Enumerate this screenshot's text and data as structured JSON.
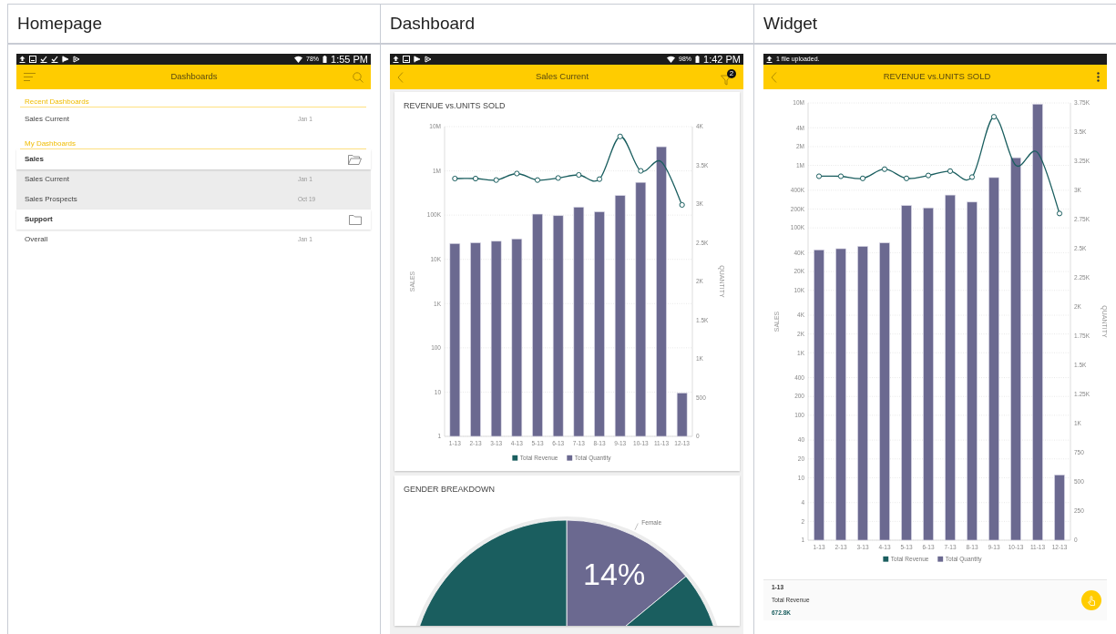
{
  "headings": [
    "Homepage",
    "Dashboard",
    "Widget"
  ],
  "homepage": {
    "status_bar": {
      "battery": "78%",
      "time": "1:55 PM"
    },
    "app_bar": {
      "title": "Dashboards"
    },
    "sections": [
      {
        "title": "Recent Dashboards",
        "items": [
          {
            "kind": "item",
            "label": "Sales Current",
            "date": "Jan 1"
          }
        ]
      },
      {
        "title": "My Dashboards",
        "items": [
          {
            "kind": "folder",
            "label": "Sales",
            "expanded": true,
            "children": [
              {
                "label": "Sales Current",
                "date": "Jan 1"
              },
              {
                "label": "Sales Prospects",
                "date": "Oct 19"
              }
            ]
          },
          {
            "kind": "folder",
            "label": "Support",
            "expanded": false
          },
          {
            "kind": "item",
            "label": "Overall",
            "date": "Jan 1"
          }
        ]
      }
    ]
  },
  "dashboard": {
    "status_bar": {
      "battery": "98%",
      "time": "1:42 PM"
    },
    "app_bar": {
      "title": "Sales Current",
      "filter_count": "2"
    },
    "widgets": [
      {
        "kind": "combo",
        "chart_data": {
          "type": "bar",
          "title": "REVENUE vs.UNITS SOLD",
          "ylabel": "SALES",
          "y2label": "QUANTITY",
          "log": true,
          "grid": true,
          "legend": "bottom",
          "ylim": [
            1,
            10000000
          ],
          "y2lim": [
            0,
            4000
          ],
          "categories": [
            "1-13",
            "2-13",
            "3-13",
            "4-13",
            "5-13",
            "6-13",
            "7-13",
            "8-13",
            "9-13",
            "10-13",
            "11-13",
            "12-13"
          ],
          "yticks": [
            {
              "value": 1,
              "label": "1"
            },
            {
              "value": 10,
              "label": "10"
            },
            {
              "value": 100,
              "label": "100"
            },
            {
              "value": 1000,
              "label": "1K"
            },
            {
              "value": 10000,
              "label": "10K"
            },
            {
              "value": 100000,
              "label": "100K"
            },
            {
              "value": 1000000,
              "label": "1M"
            },
            {
              "value": 10000000,
              "label": "10M"
            }
          ],
          "y2ticks": [
            {
              "value": 0,
              "label": "0"
            },
            {
              "value": 500,
              "label": "500"
            },
            {
              "value": 1000,
              "label": "1K"
            },
            {
              "value": 1500,
              "label": "1.5K"
            },
            {
              "value": 2000,
              "label": "2K"
            },
            {
              "value": 2500,
              "label": "2.5K"
            },
            {
              "value": 3000,
              "label": "3K"
            },
            {
              "value": 3500,
              "label": "3.5K"
            },
            {
              "value": 4000,
              "label": "4K"
            }
          ],
          "series": [
            {
              "name": "Total Revenue",
              "color": "#1a5e5f",
              "type": "line",
              "marker": true,
              "values": [
                670000,
                670000,
                620000,
                870000,
                620000,
                690000,
                810000,
                650000,
                6000000,
                1000000,
                1600000,
                170000
              ]
            },
            {
              "name": "Total Quantity",
              "color": "#6b6990",
              "axis": "y2",
              "values": [
                2490,
                2500,
                2520,
                2550,
                2870,
                2850,
                2960,
                2900,
                3110,
                3280,
                3740,
                560
              ]
            }
          ]
        }
      },
      {
        "kind": "pie",
        "chart_data": {
          "type": "pie",
          "title": "GENDER BREAKDOWN",
          "categories": [
            "Female",
            null
          ],
          "values": [
            14,
            86
          ],
          "value_labels": [
            "14%",
            null
          ]
        }
      }
    ]
  },
  "widget": {
    "notification": "1 file uploaded.",
    "app_bar": {
      "title": "REVENUE vs.UNITS SOLD"
    },
    "chart_data": {
      "type": "bar",
      "ylabel": "SALES",
      "y2label": "QUANTITY",
      "log": true,
      "grid": true,
      "legend": "bottom",
      "ylim": [
        1,
        10000000
      ],
      "y2lim": [
        0,
        3750
      ],
      "categories": [
        "1-13",
        "2-13",
        "3-13",
        "4-13",
        "5-13",
        "6-13",
        "7-13",
        "8-13",
        "9-13",
        "10-13",
        "11-13",
        "12-13"
      ],
      "yticks": [
        {
          "value": 1,
          "label": "1"
        },
        {
          "value": 2,
          "label": "2"
        },
        {
          "value": 4,
          "label": "4"
        },
        {
          "value": 10,
          "label": "10"
        },
        {
          "value": 20,
          "label": "20"
        },
        {
          "value": 40,
          "label": "40"
        },
        {
          "value": 100,
          "label": "100"
        },
        {
          "value": 200,
          "label": "200"
        },
        {
          "value": 400,
          "label": "400"
        },
        {
          "value": 1000,
          "label": "1K"
        },
        {
          "value": 2000,
          "label": "2K"
        },
        {
          "value": 4000,
          "label": "4K"
        },
        {
          "value": 10000,
          "label": "10K"
        },
        {
          "value": 20000,
          "label": "20K"
        },
        {
          "value": 40000,
          "label": "40K"
        },
        {
          "value": 100000,
          "label": "100K"
        },
        {
          "value": 200000,
          "label": "200K"
        },
        {
          "value": 400000,
          "label": "400K"
        },
        {
          "value": 1000000,
          "label": "1M"
        },
        {
          "value": 2000000,
          "label": "2M"
        },
        {
          "value": 4000000,
          "label": "4M"
        },
        {
          "value": 10000000,
          "label": "10M"
        }
      ],
      "y2ticks": [
        {
          "value": 0,
          "label": "0"
        },
        {
          "value": 250,
          "label": "250"
        },
        {
          "value": 500,
          "label": "500"
        },
        {
          "value": 750,
          "label": "750"
        },
        {
          "value": 1000,
          "label": "1K"
        },
        {
          "value": 1250,
          "label": "1.25K"
        },
        {
          "value": 1500,
          "label": "1.5K"
        },
        {
          "value": 1750,
          "label": "1.75K"
        },
        {
          "value": 2000,
          "label": "2K"
        },
        {
          "value": 2250,
          "label": "2.25K"
        },
        {
          "value": 2500,
          "label": "2.5K"
        },
        {
          "value": 2750,
          "label": "2.75K"
        },
        {
          "value": 3000,
          "label": "3K"
        },
        {
          "value": 3250,
          "label": "3.25K"
        },
        {
          "value": 3500,
          "label": "3.5K"
        },
        {
          "value": 3750,
          "label": "3.75K"
        }
      ],
      "series": [
        {
          "name": "Total Revenue",
          "color": "#1a5e5f",
          "type": "line",
          "marker": true,
          "values": [
            670000,
            670000,
            620000,
            870000,
            620000,
            690000,
            810000,
            650000,
            6000000,
            1000000,
            1600000,
            170000
          ]
        },
        {
          "name": "Total Quantity",
          "color": "#6b6990",
          "axis": "y2",
          "values": [
            2490,
            2500,
            2520,
            2550,
            2870,
            2850,
            2960,
            2900,
            3110,
            3280,
            3740,
            560
          ]
        }
      ]
    },
    "detail": {
      "category": "1-13",
      "series": "Total Revenue",
      "value": "672.8K"
    }
  }
}
